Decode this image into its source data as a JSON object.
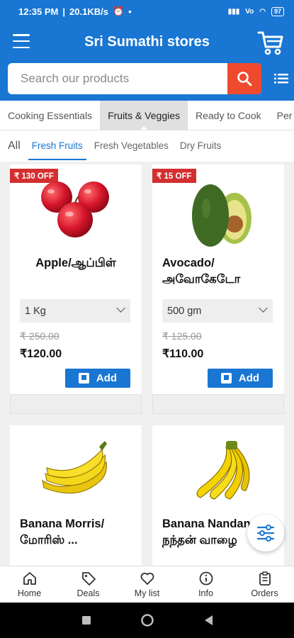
{
  "status_bar": {
    "time": "12:35 PM",
    "net_speed": "20.1KB/s",
    "battery": "97"
  },
  "header": {
    "title": "Sri Sumathi stores"
  },
  "search": {
    "placeholder": "Search our products"
  },
  "categories": [
    {
      "label": "Cooking Essentials",
      "active": false
    },
    {
      "label": "Fruits & Veggies",
      "active": true
    },
    {
      "label": "Ready to Cook",
      "active": false
    },
    {
      "label": "Per",
      "active": false
    }
  ],
  "subcategories": [
    {
      "label": "All",
      "active": false
    },
    {
      "label": "Fresh Fruits",
      "active": true
    },
    {
      "label": "Fresh Vegetables",
      "active": false
    },
    {
      "label": "Dry Fruits",
      "active": false
    }
  ],
  "products": [
    {
      "offer": "₹ 130 OFF",
      "name": "Apple/ஆப்பிள்",
      "variant": "1 Kg",
      "mrp": "₹ 250.00",
      "price": "₹120.00",
      "add_label": "Add",
      "image": "apple"
    },
    {
      "offer": "₹ 15 OFF",
      "name": "Avocado/\nஅவோகேடோ",
      "variant": "500 gm",
      "mrp": "₹ 125.00",
      "price": "₹110.00",
      "add_label": "Add",
      "image": "avocado"
    },
    {
      "name": "Banana Morris/\nமோரிஸ் ...",
      "image": "banana"
    },
    {
      "name": "Banana Nandan /\nநந்தன் வாழை",
      "image": "banana-bunch"
    }
  ],
  "bottom_nav": [
    {
      "label": "Home",
      "icon": "home-icon"
    },
    {
      "label": "Deals",
      "icon": "tag-icon"
    },
    {
      "label": "My list",
      "icon": "heart-icon"
    },
    {
      "label": "Info",
      "icon": "info-icon"
    },
    {
      "label": "Orders",
      "icon": "clipboard-icon"
    }
  ],
  "colors": {
    "primary": "#1976d2",
    "search_button": "#f04a2e",
    "offer_badge": "#d32f2f"
  }
}
